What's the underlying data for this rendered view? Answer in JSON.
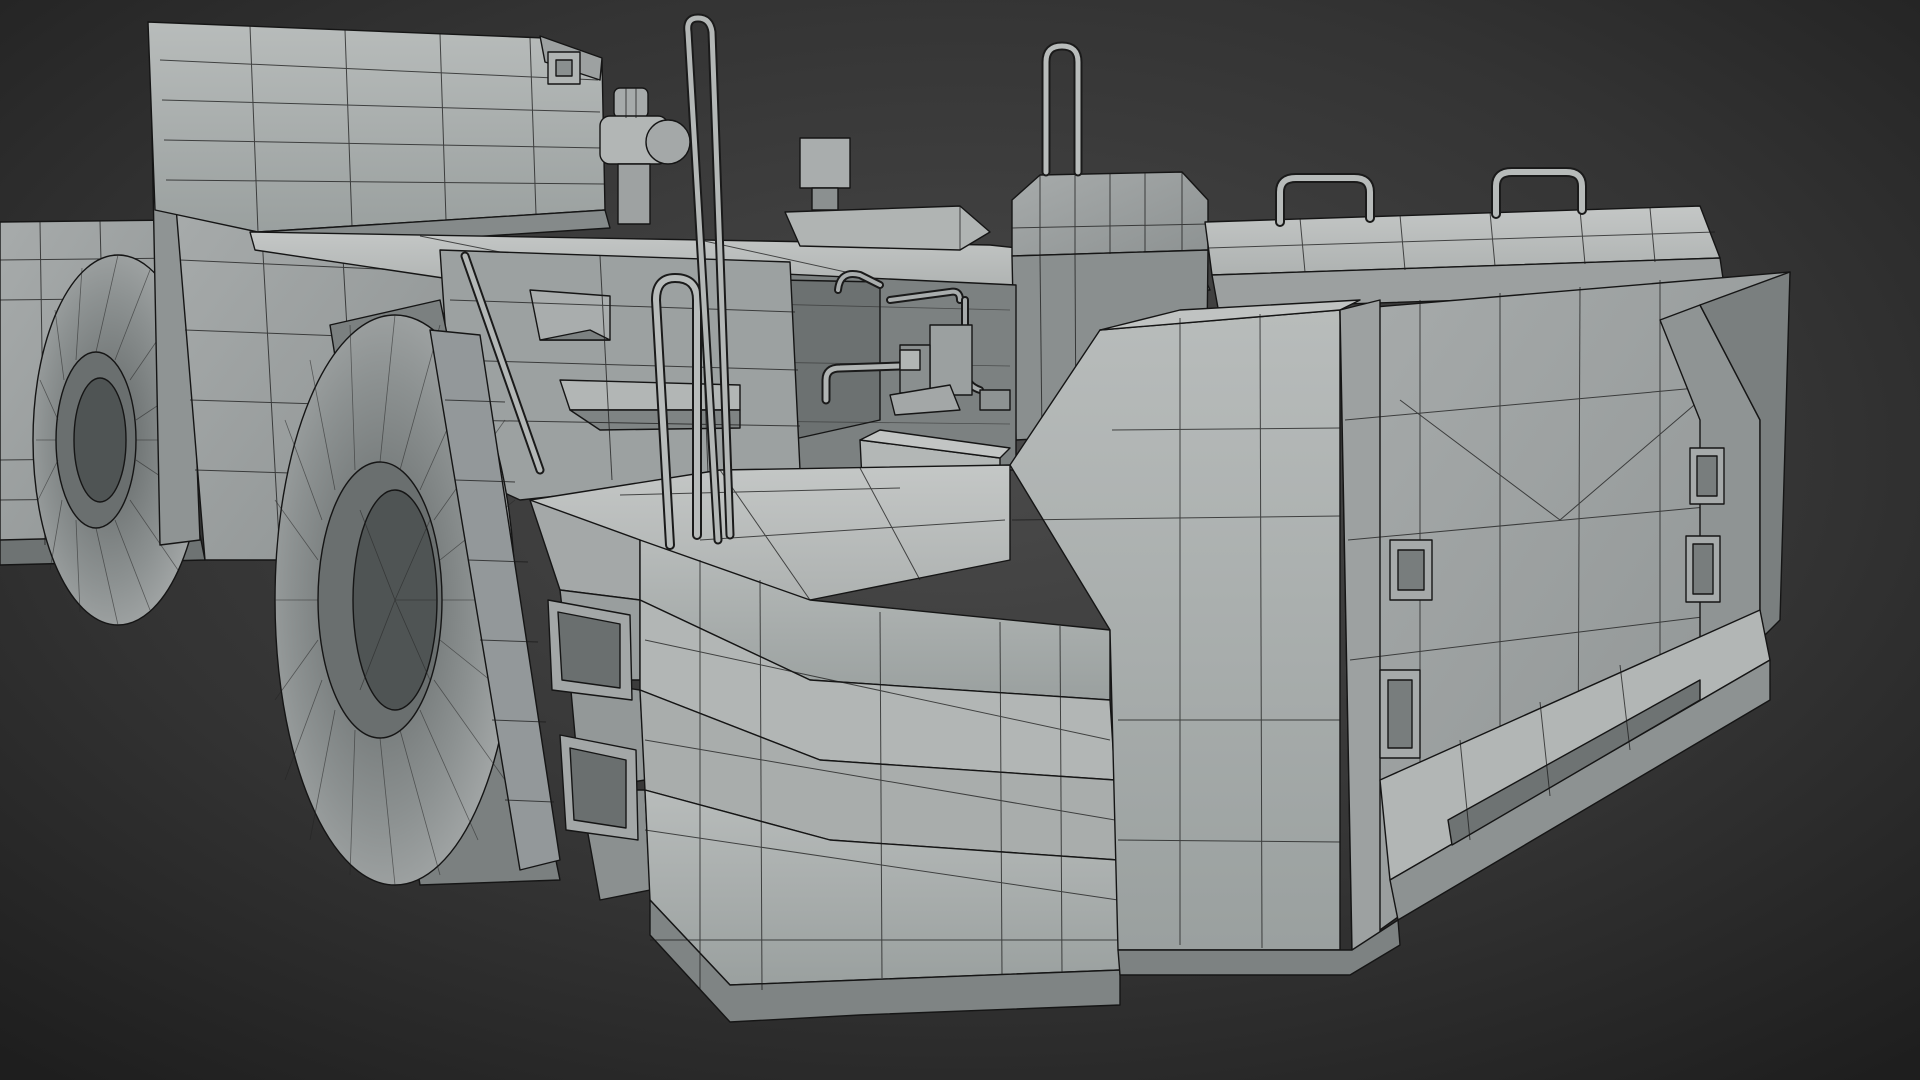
{
  "scene": {
    "kind": "3d-viewport",
    "subject": "wireframe-shaded-mining-vehicle",
    "display_mode": "solid-with-wireframe",
    "colors": {
      "background_center": "#484848",
      "background_edge": "#1f1f1f",
      "surface_light": "#b9bdbc",
      "surface_mid": "#9ea2a2",
      "surface_dark": "#7d8282",
      "surface_shadow": "#5f6464",
      "wire": "#1a1a1a"
    }
  }
}
